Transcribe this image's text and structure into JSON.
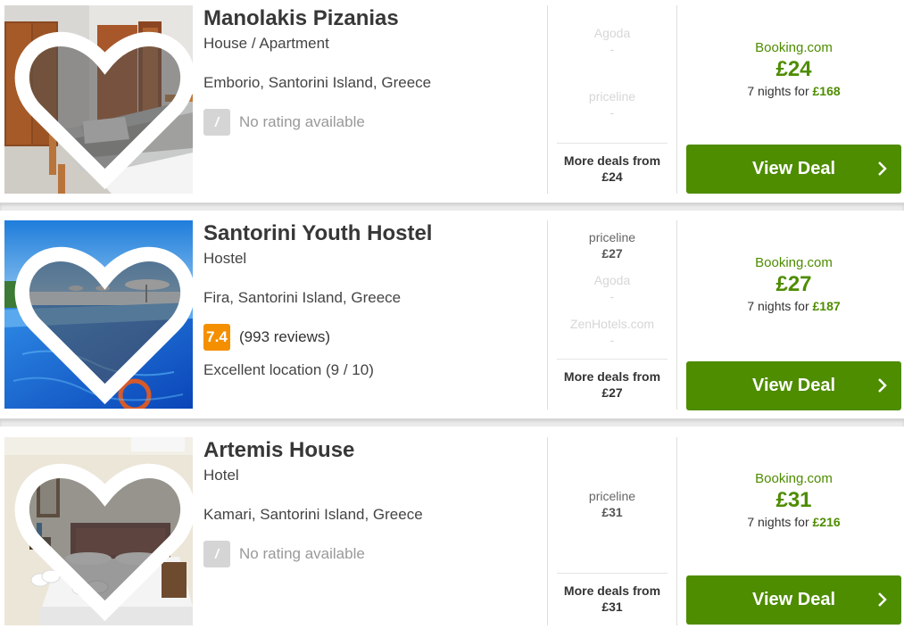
{
  "listings": [
    {
      "name": "Manolakis Pizanias",
      "type": "House / Apartment",
      "location": "Emborio, Santorini Island, Greece",
      "rating_badge": "/",
      "rating_text": "No rating available",
      "deals": [
        {
          "provider": "Agoda",
          "price": "-"
        },
        {
          "provider": "priceline",
          "price": "-"
        }
      ],
      "more_deals_label": "More deals from",
      "more_deals_price": "£24",
      "best_provider": "Booking.com",
      "best_price": "£24",
      "nights_prefix": "7 nights for",
      "nights_total": "£168",
      "cta_label": "View Deal"
    },
    {
      "name": "Santorini Youth Hostel",
      "type": "Hostel",
      "location": "Fira, Santorini Island, Greece",
      "rating_badge": "7.4",
      "rating_text": "(993 reviews)",
      "extra": "Excellent location (9 / 10)",
      "deals": [
        {
          "provider": "priceline",
          "price": "£27"
        },
        {
          "provider": "Agoda",
          "price": "-"
        },
        {
          "provider": "ZenHotels.com",
          "price": "-"
        }
      ],
      "more_deals_label": "More deals from",
      "more_deals_price": "£27",
      "best_provider": "Booking.com",
      "best_price": "£27",
      "nights_prefix": "7 nights for",
      "nights_total": "£187",
      "cta_label": "View Deal"
    },
    {
      "name": "Artemis House",
      "type": "Hotel",
      "location": "Kamari, Santorini Island, Greece",
      "rating_badge": "/",
      "rating_text": "No rating available",
      "deals": [
        {
          "provider": "priceline",
          "price": "£31"
        }
      ],
      "more_deals_label": "More deals from",
      "more_deals_price": "£31",
      "best_provider": "Booking.com",
      "best_price": "£31",
      "nights_prefix": "7 nights for",
      "nights_total": "£216",
      "cta_label": "View Deal"
    }
  ],
  "colors": {
    "brand_green": "#4e8c00",
    "rating_orange": "#f48f00",
    "no_rating_gray": "#d5d5d5"
  },
  "icons": {
    "favorite": "heart-icon",
    "cta_arrow": "chevron-right-icon"
  }
}
